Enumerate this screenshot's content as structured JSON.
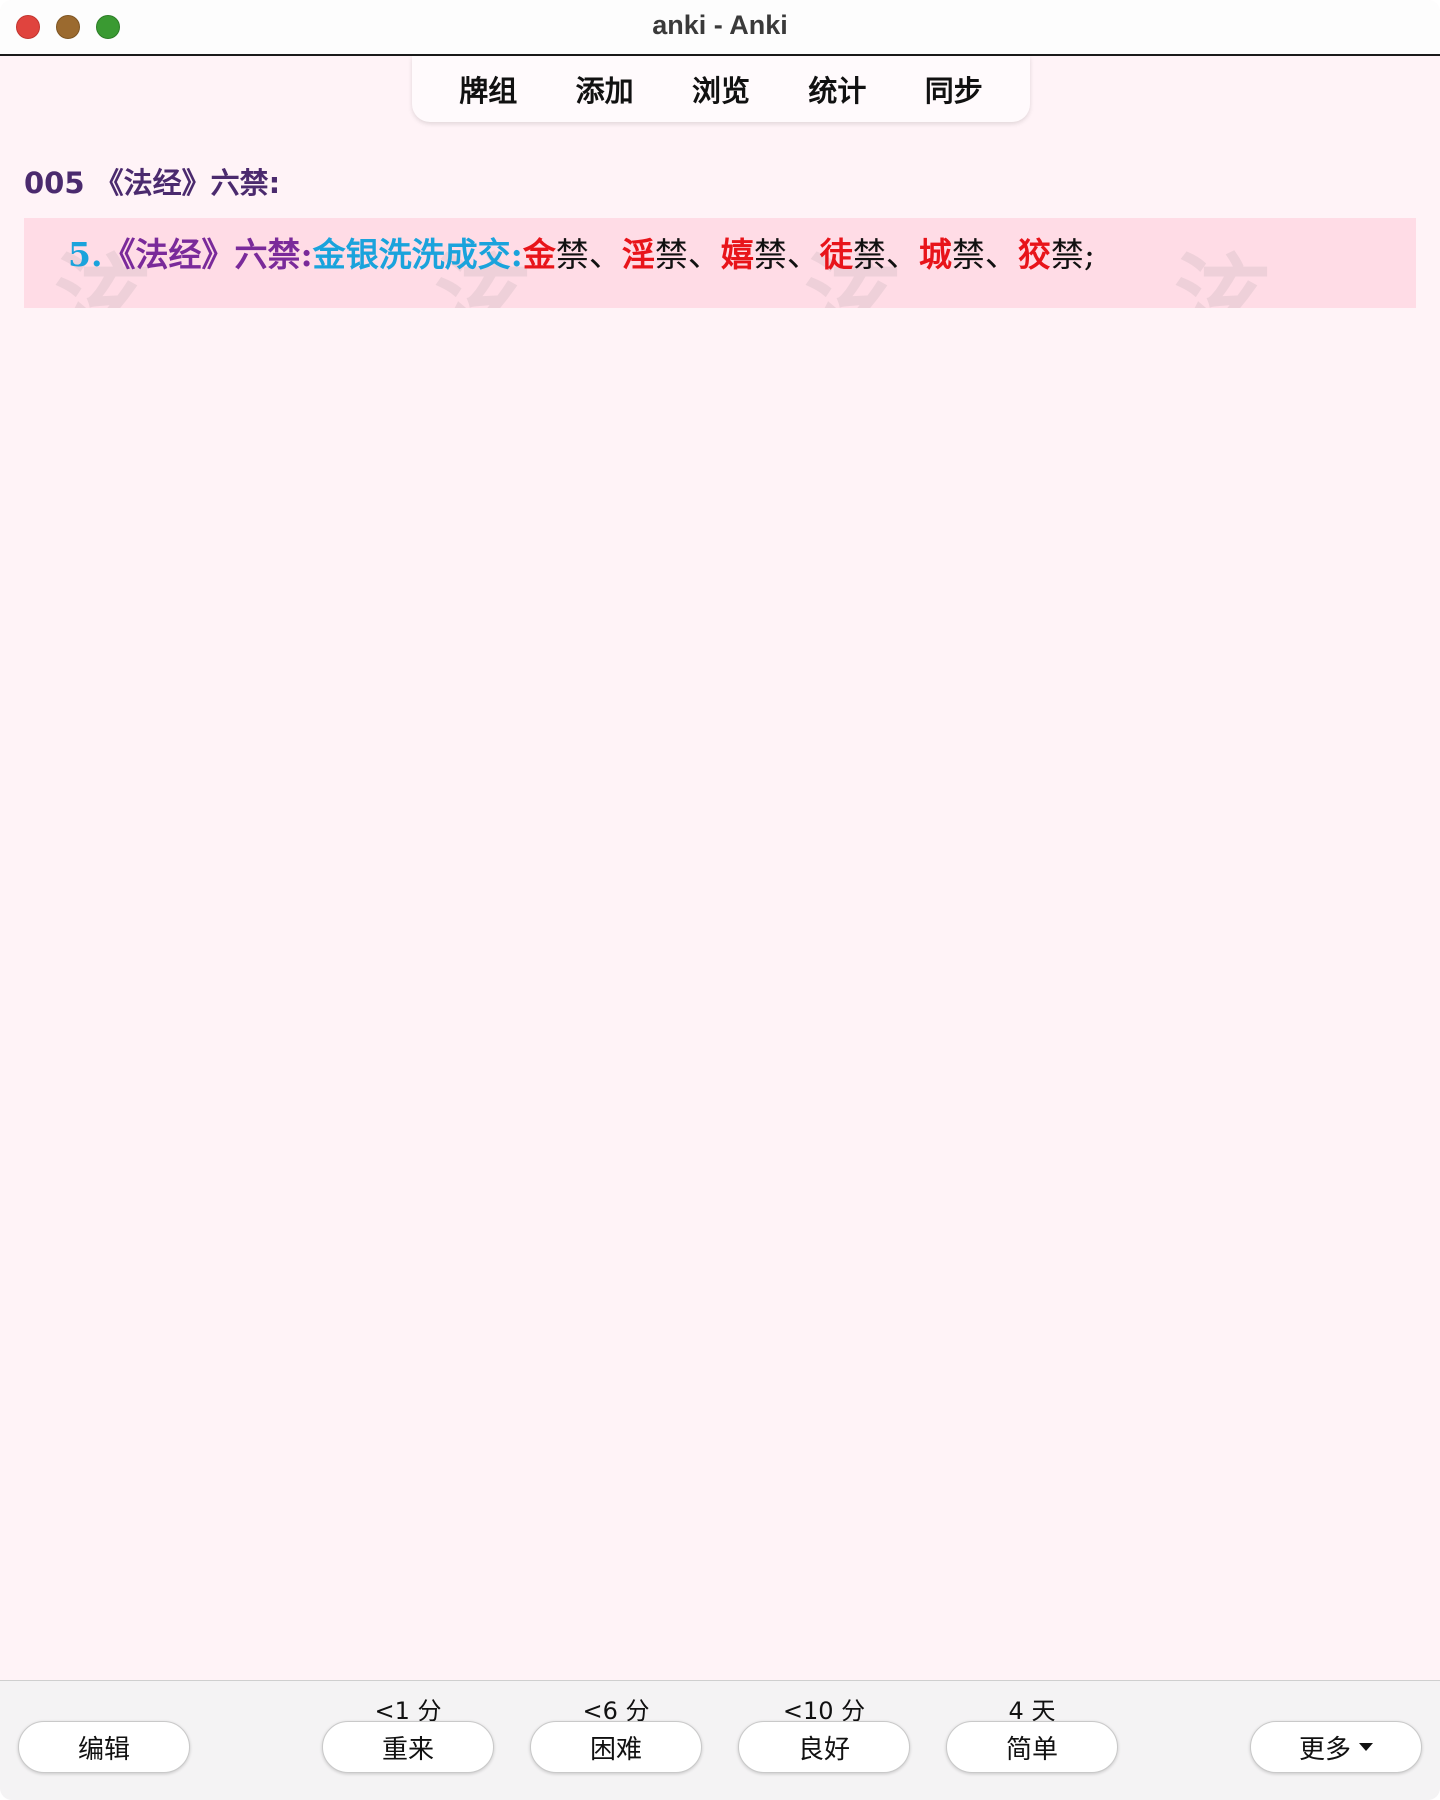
{
  "window": {
    "title": "anki - Anki"
  },
  "toolbar": {
    "items": [
      {
        "label": "牌组"
      },
      {
        "label": "添加"
      },
      {
        "label": "浏览"
      },
      {
        "label": "统计"
      },
      {
        "label": "同步"
      }
    ]
  },
  "card": {
    "heading": "005 《法经》六禁:",
    "line": {
      "number": "5.",
      "title": "《法经》六禁:",
      "mnemonic": "金银洗洗成交:",
      "items": [
        {
          "key": "金",
          "rest": "禁、"
        },
        {
          "key": "淫",
          "rest": "禁、"
        },
        {
          "key": "嬉",
          "rest": "禁、"
        },
        {
          "key": "徒",
          "rest": "禁、"
        },
        {
          "key": "城",
          "rest": "禁、"
        },
        {
          "key": "狡",
          "rest": "禁;"
        }
      ]
    },
    "watermark": "泫"
  },
  "bottom": {
    "edit_label": "编辑",
    "more_label": "更多",
    "answers": [
      {
        "interval": "<1 分",
        "label": "重来"
      },
      {
        "interval": "<6 分",
        "label": "困难"
      },
      {
        "interval": "<10 分",
        "label": "良好"
      },
      {
        "interval": "4 天",
        "label": "简单"
      }
    ]
  },
  "colors": {
    "background": "#fff3f7",
    "card_box": "#ffdce6",
    "heading": "#4b2a6e",
    "number_blue": "#1aa3dc",
    "title_purple": "#7a2a9a",
    "key_red": "#e8141a"
  }
}
